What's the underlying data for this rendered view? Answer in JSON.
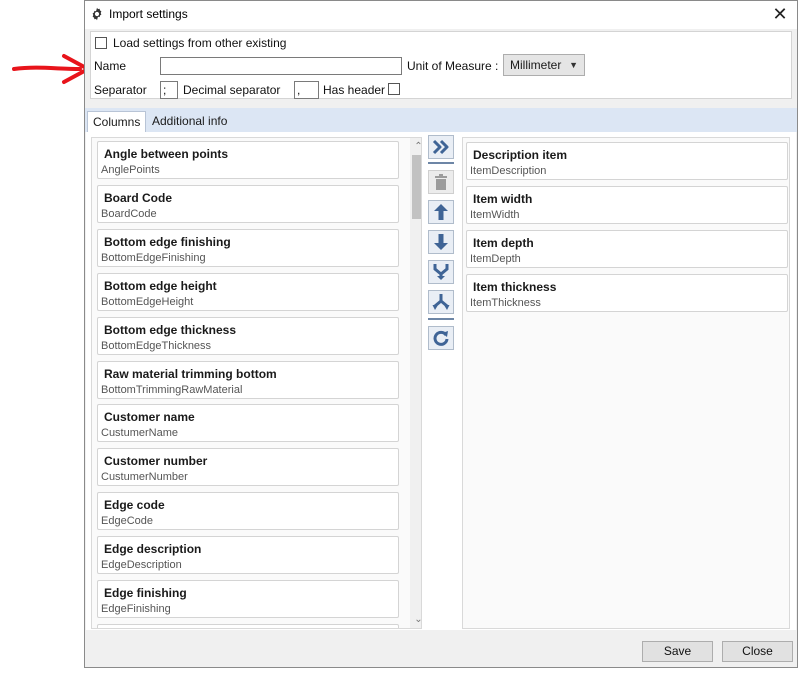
{
  "window": {
    "title": "Import settings",
    "close_icon": "close-icon"
  },
  "top": {
    "load_settings_label": "Load settings from other existing",
    "name_label": "Name",
    "name_value": "",
    "uom_label": "Unit of Measure :",
    "uom_value": "Millimeter",
    "separator_label": "Separator",
    "separator_value": ";",
    "decimal_label": "Decimal separator",
    "decimal_value": ",",
    "has_header_label": "Has header"
  },
  "tabs": [
    {
      "label": "Columns",
      "active": true
    },
    {
      "label": "Additional info",
      "active": false
    }
  ],
  "available_columns": [
    {
      "name": "Angle between points",
      "code": "AnglePoints"
    },
    {
      "name": "Board Code",
      "code": "BoardCode"
    },
    {
      "name": "Bottom edge finishing",
      "code": "BottomEdgeFinishing"
    },
    {
      "name": "Bottom edge height",
      "code": "BottomEdgeHeight"
    },
    {
      "name": "Bottom edge thickness",
      "code": "BottomEdgeThickness"
    },
    {
      "name": "Raw material trimming bottom",
      "code": "BottomTrimmingRawMaterial"
    },
    {
      "name": "Customer name",
      "code": "CustumerName"
    },
    {
      "name": "Customer number",
      "code": "CustumerNumber"
    },
    {
      "name": "Edge code",
      "code": "EdgeCode"
    },
    {
      "name": "Edge description",
      "code": "EdgeDescription"
    },
    {
      "name": "Edge finishing",
      "code": "EdgeFinishing"
    }
  ],
  "selected_columns": [
    {
      "name": "Description item",
      "code": "ItemDescription"
    },
    {
      "name": "Item width",
      "code": "ItemWidth"
    },
    {
      "name": "Item depth",
      "code": "ItemDepth"
    },
    {
      "name": "Item thickness",
      "code": "ItemThickness"
    }
  ],
  "toolbar_icons": [
    "add-all-icon",
    "delete-icon",
    "move-up-icon",
    "move-down-icon",
    "merge-icon",
    "split-icon",
    "refresh-icon"
  ],
  "buttons": {
    "save": "Save",
    "close": "Close"
  },
  "colors": {
    "annotation_arrow": "#e8141b",
    "tab_bar": "#dce6f4",
    "tool_icon": "#3f6496"
  }
}
